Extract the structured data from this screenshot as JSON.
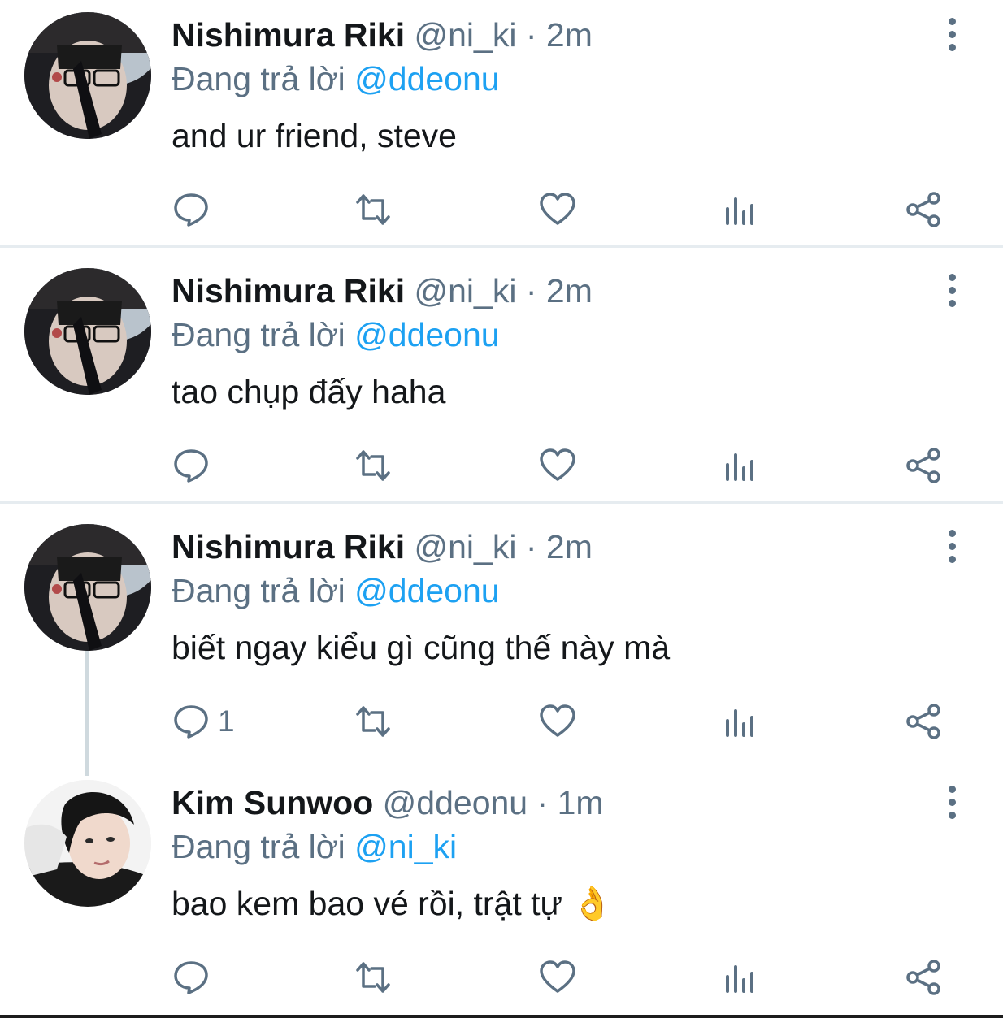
{
  "tweets": [
    {
      "name": "Nishimura Riki",
      "handle": "@ni_ki",
      "separator": "·",
      "time": "2m",
      "reply_prefix": "Đang trả lời",
      "reply_to": "@ddeonu",
      "text": "and ur friend, steve",
      "reply_count": ""
    },
    {
      "name": "Nishimura Riki",
      "handle": "@ni_ki",
      "separator": "·",
      "time": "2m",
      "reply_prefix": "Đang trả lời",
      "reply_to": "@ddeonu",
      "text": "tao chụp đấy haha",
      "reply_count": ""
    },
    {
      "name": "Nishimura Riki",
      "handle": "@ni_ki",
      "separator": "·",
      "time": "2m",
      "reply_prefix": "Đang trả lời",
      "reply_to": "@ddeonu",
      "text": "biết ngay kiểu gì cũng thế này mà",
      "reply_count": "1"
    },
    {
      "name": "Kim Sunwoo",
      "handle": "@ddeonu",
      "separator": "·",
      "time": "1m",
      "reply_prefix": "Đang trả lời",
      "reply_to": "@ni_ki",
      "text": "bao kem bao vé rồi, trật tự 👌",
      "reply_count": ""
    }
  ],
  "icons": [
    "reply-icon",
    "retweet-icon",
    "like-icon",
    "analytics-icon",
    "share-icon",
    "more-options-icon"
  ],
  "colors": {
    "accent": "#1da1f2",
    "secondary_text": "#5b7083",
    "divider": "#e6ecf0"
  }
}
